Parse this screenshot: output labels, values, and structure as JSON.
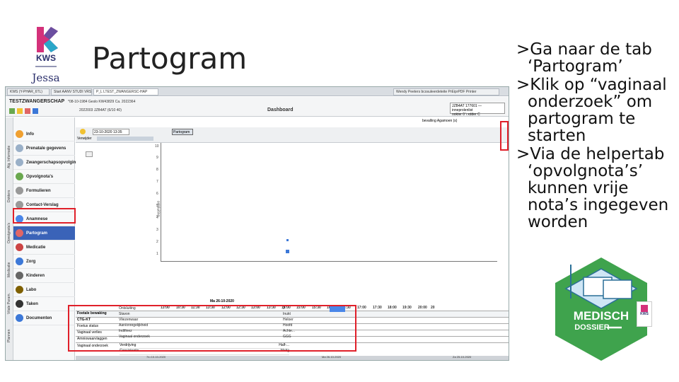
{
  "slide": {
    "title": "Partogram",
    "bullets": [
      ">Ga naar de tab ‘Partogram’",
      ">Klik op “vaginaal onderzoek” om partogram te starten",
      ">Via de helpertab ‘opvolgnota’s’ kunnen vrije nota’s ingegeven worden"
    ],
    "logo": {
      "brand": "KWS",
      "sub": "Jessa"
    },
    "graphic": {
      "title": "MEDISCH",
      "subtitle": "DOSSIER",
      "badge": "KWS"
    }
  },
  "app": {
    "tabs": [
      {
        "label": "KWS (Y-PHAR_6TL)"
      },
      {
        "label": "Start   AANV   STUDI   VRS   INKRAMAMAP"
      },
      {
        "label": "P_L  LTEST_ZWANGERSC-HAP"
      },
      {
        "label": "Wendy Peeters   bcosuleerdeteite   PrEiprPDF Printer"
      }
    ],
    "patient_name": "TESTZWANGERSCHAP",
    "patient_line1": "*08-10-1984  Geslo  KW43829  Ca. 2022364",
    "patient_line2": "2022003  JZB4AT  (6/10 40)",
    "dashboard_label": "Dashboard",
    "search_line1": "JZB4AT 177601 — inneprolenlist",
    "search_line2": "ookter 0  \\  xdder C",
    "viewer_label": "bevalling Agamoen (s)",
    "colors": {
      "accent": "#3a63b8",
      "highlight": "#e0202a",
      "green": "#3fa34d"
    }
  },
  "vertical_tabs": [
    "Alg. Informatie",
    "Dokters",
    "Opvolgnota's",
    "Medicatie",
    "Vitale Param.",
    "Plannen"
  ],
  "sidebar": {
    "items": [
      {
        "label": "Info",
        "icon": "info-icon",
        "color": "#f0a030"
      },
      {
        "label": "Prenatale gegevens",
        "icon": "prenatal-icon",
        "color": "#9ab0c8"
      },
      {
        "label": "Zwangerschapsopvolging",
        "icon": "pregnancy-icon",
        "color": "#9ab0c8"
      },
      {
        "label": "Opvolgnota's",
        "icon": "notes-icon",
        "color": "#6aa84f"
      },
      {
        "label": "Formulieren",
        "icon": "forms-icon",
        "color": "#999999"
      },
      {
        "label": "Contact-Verslag",
        "icon": "report-icon",
        "color": "#999999"
      },
      {
        "label": "Anamnese",
        "icon": "anamnesis-icon",
        "color": "#4a86e8"
      },
      {
        "label": "Partogram",
        "icon": "partogram-icon",
        "color": "#e06666",
        "active": true
      },
      {
        "label": "Medicatie",
        "icon": "medication-icon",
        "color": "#cc4444"
      },
      {
        "label": "Zorg",
        "icon": "care-icon",
        "color": "#3c78d8"
      },
      {
        "label": "Kinderen",
        "icon": "children-icon",
        "color": "#666666"
      },
      {
        "label": "Labo",
        "icon": "lab-icon",
        "color": "#7f6000"
      },
      {
        "label": "Taken",
        "icon": "tasks-icon",
        "color": "#333333"
      },
      {
        "label": "Documenten",
        "icon": "documents-icon",
        "color": "#3c78d8"
      }
    ]
  },
  "main": {
    "date_value": "23-10-2020   13:35",
    "partogram_btn": "Partogram",
    "verwijder_label": "Verwijder",
    "y_ticks": [
      "10",
      "9",
      "8",
      "7",
      "6",
      "5",
      "4",
      "3",
      "2",
      "1"
    ],
    "y_axis_label": "ontsluiting",
    "date_header": "Ma 26-10-2020",
    "times": [
      "13:00",
      "10:30",
      "11:30",
      "13:30",
      "12:00",
      "12:30",
      "13:00",
      "13:30",
      "14:00",
      "15:00",
      "15:30",
      "16:00",
      "16:30",
      "17:00",
      "17:30",
      "18:00",
      "19:30",
      "20:00",
      "20"
    ],
    "sections": [
      "Foetale bewaking",
      "CTG-KT",
      "Foetus status",
      "Vaginaal verlies",
      "Amniowaarvlaggen"
    ],
    "vo_group": "Vaginaal onderzoek",
    "vo_rows": [
      {
        "label": "Verdrijving",
        "value": "Half-..."
      },
      {
        "label": "Consistentie",
        "value": "Matig"
      },
      {
        "label": "Ontsluiting",
        "value": "2"
      },
      {
        "label": "Stavon",
        "value": "Inukt"
      },
      {
        "label": "Vliezenwaar",
        "value": "Heloer"
      },
      {
        "label": "Aan/onregelijkheid",
        "value": "Hoofd"
      },
      {
        "label": "Indifinez",
        "value": "Achte..."
      },
      {
        "label": "Vaginaal onderzoek",
        "value": "GGG"
      }
    ],
    "footer_dates": [
      "7/u 10-10-2020",
      "Ma 26-10-2020",
      "Za 25-10-2020"
    ]
  }
}
